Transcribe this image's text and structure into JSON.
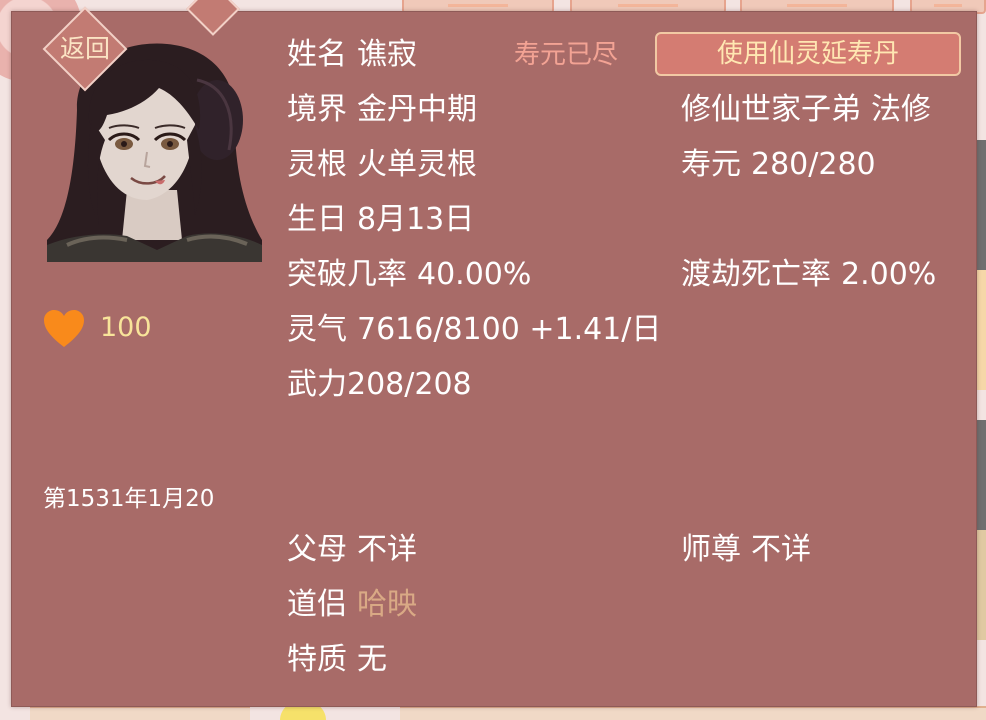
{
  "dialog": {
    "back_label": "返回",
    "use_pill_label": "使用仙灵延寿丹",
    "lifespan_status": "寿元已尽",
    "favor": "100",
    "game_date": "第1531年1月20"
  },
  "character": {
    "name_label": "姓名",
    "name": "谯寂",
    "realm_label": "境界",
    "realm": "金丹中期",
    "root_label": "灵根",
    "root": "火单灵根",
    "birthday_label": "生日",
    "birthday": "8月13日",
    "breakthrough_label": "突破几率",
    "breakthrough": "40.00%",
    "qi_label": "灵气",
    "qi": "7616/8100 +1.41/日",
    "force_text": "武力208/208",
    "origin": "修仙世家子弟",
    "school": "法修",
    "lifespan_label": "寿元",
    "lifespan": "280/280",
    "tribulation_label": "渡劫死亡率",
    "tribulation": "2.00%",
    "parents_label": "父母",
    "parents": "不详",
    "master_label": "师尊",
    "master": "不详",
    "partner_label": "道侣",
    "partner": "哈映",
    "trait_label": "特质",
    "trait": "无"
  },
  "colors": {
    "panel": "#a86b68",
    "text": "#ffffff",
    "favor": "#f8e49a",
    "status_warning": "#f3a394",
    "partner_link": "#d9a985",
    "button_fill": "#d47c72",
    "heart": "#f98a1b"
  },
  "icons": [
    "heart-icon"
  ]
}
